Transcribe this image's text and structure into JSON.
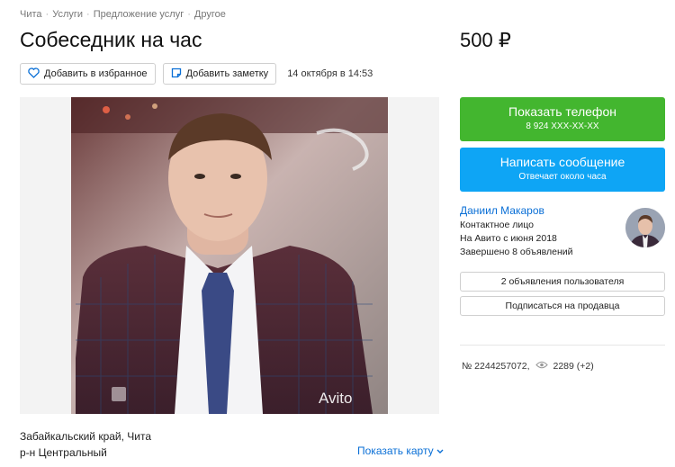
{
  "breadcrumbs": [
    "Чита",
    "Услуги",
    "Предложение услуг",
    "Другое"
  ],
  "ad": {
    "title": "Собеседник на час",
    "price": "500 ₽",
    "favorite_label": "Добавить в избранное",
    "note_label": "Добавить заметку",
    "date": "14 октября в 14:53",
    "watermark": "Avito",
    "address_line1": "Забайкальский край, Чита",
    "address_line2": "р-н Центральный",
    "show_map": "Показать карту",
    "ad_number": "№ 2244257072,",
    "views": "2289 (+2)"
  },
  "contact": {
    "phone_button": "Показать телефон",
    "phone_masked": "8 924 XXX-XX-XX",
    "message_button": "Написать сообщение",
    "reply_time": "Отвечает около часа"
  },
  "seller": {
    "name": "Даниил Макаров",
    "role": "Контактное лицо",
    "since": "На Авито с июня 2018",
    "completed": "Завершено 8 объявлений",
    "ads_button": "2 объявления пользователя",
    "subscribe_button": "Подписаться на продавца"
  },
  "colors": {
    "green": "#43b62f",
    "blue": "#0ea5f5",
    "link": "#0a6fd6"
  }
}
